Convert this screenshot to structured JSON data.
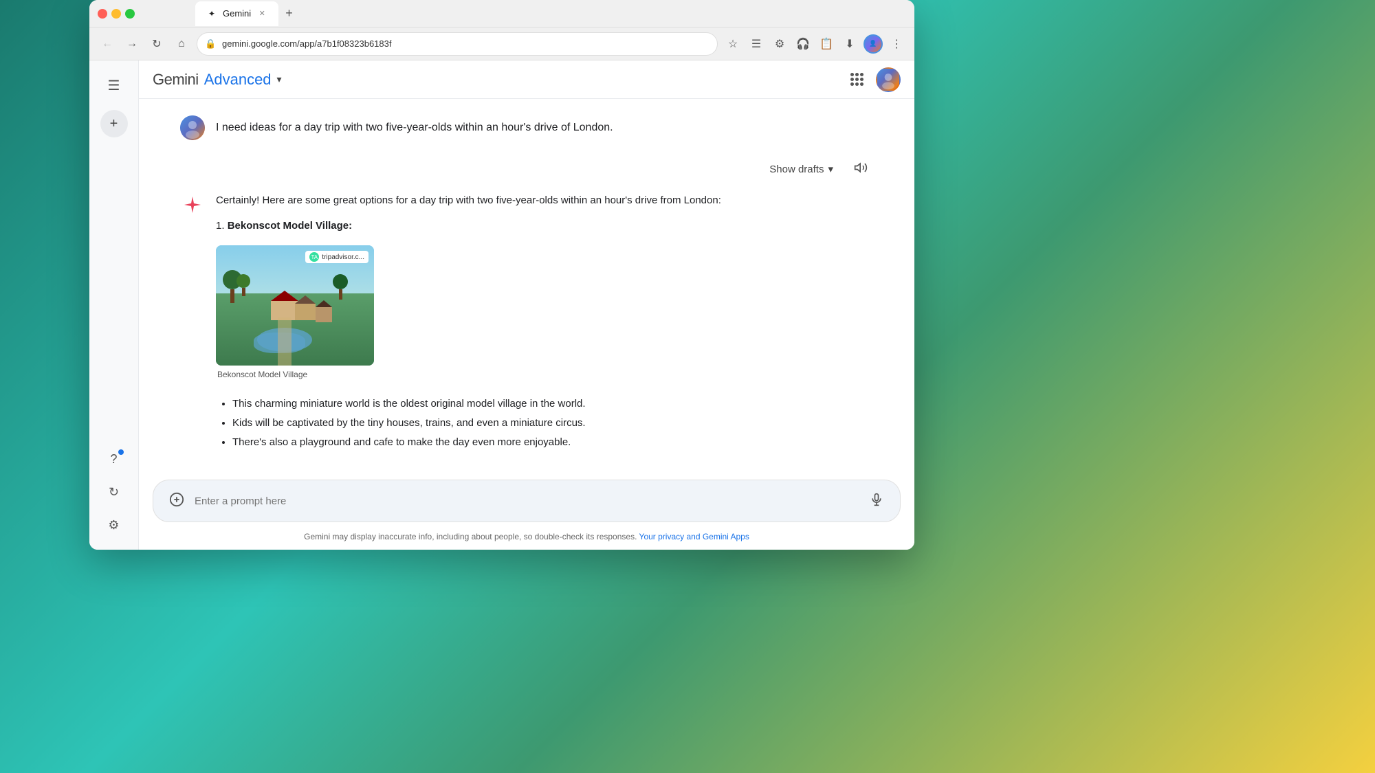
{
  "browser": {
    "url": "gemini.google.com/app/a7b1f08323b6183f",
    "tab_label": "Gemini",
    "new_tab_symbol": "+",
    "back_symbol": "←",
    "forward_symbol": "→",
    "refresh_symbol": "↻",
    "home_symbol": "⌂"
  },
  "header": {
    "app_name": "Gemini",
    "app_plan": "Advanced",
    "dropdown_symbol": "▾",
    "hamburger_symbol": "☰",
    "new_chat_symbol": "+"
  },
  "user_message": {
    "text": "I need ideas for a day trip with two five-year-olds within an hour's drive of London."
  },
  "drafts": {
    "label": "Show drafts",
    "chevron": "▾",
    "speaker_symbol": "🔊"
  },
  "ai_response": {
    "intro": "Certainly! Here are some great options for a day trip with two five-year-olds within an hour's drive from London:",
    "item_number": "1.",
    "item_title": "Bekonscot Model Village:",
    "image_caption": "Bekonscot Model Village",
    "tripadvisor_label": "tripadvisor.c...",
    "bullets": [
      "This charming miniature world is the oldest original model village in the world.",
      "Kids will be captivated by the tiny houses, trains, and even a miniature circus.",
      "There's also a playground and cafe to make the day even more enjoyable."
    ]
  },
  "prompt": {
    "placeholder": "Enter a prompt here",
    "add_symbol": "⊕",
    "mic_symbol": "🎤"
  },
  "footer": {
    "text": "Gemini may display inaccurate info, including about people, so double-check its responses.",
    "link_text": "Your privacy and Gemini Apps",
    "link_url": "#"
  },
  "sidebar": {
    "help_symbol": "?",
    "history_symbol": "↺",
    "settings_symbol": "⚙"
  },
  "colors": {
    "accent_blue": "#1a73e8",
    "gemini_star": "#e8425a",
    "text_dark": "#202124"
  }
}
